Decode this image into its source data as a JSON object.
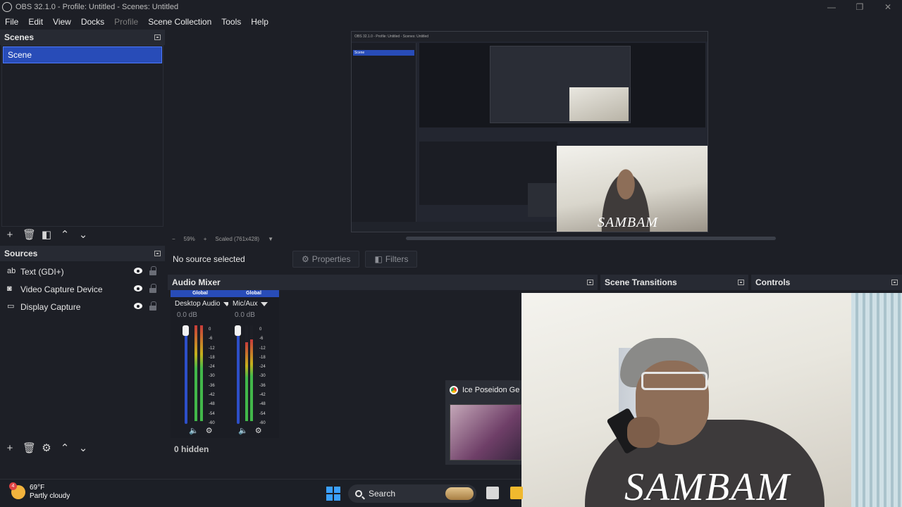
{
  "window": {
    "title": "OBS 32.1.0 - Profile: Untitled - Scenes: Untitled",
    "controls": [
      "—",
      "❐",
      "✕"
    ]
  },
  "menu": [
    {
      "label": "File",
      "enabled": true
    },
    {
      "label": "Edit",
      "enabled": true
    },
    {
      "label": "View",
      "enabled": true
    },
    {
      "label": "Docks",
      "enabled": true
    },
    {
      "label": "Profile",
      "enabled": false
    },
    {
      "label": "Scene Collection",
      "enabled": true
    },
    {
      "label": "Tools",
      "enabled": true
    },
    {
      "label": "Help",
      "enabled": true
    }
  ],
  "scenes": {
    "title": "Scenes",
    "items": [
      "Scene"
    ]
  },
  "sources": {
    "title": "Sources",
    "items": [
      {
        "label": "Text (GDI+)",
        "icon": "text-icon"
      },
      {
        "label": "Video Capture Device",
        "icon": "camera-icon"
      },
      {
        "label": "Display Capture",
        "icon": "monitor-icon"
      }
    ]
  },
  "preview": {
    "zoom": "59%",
    "scale_mode": "Scaled (761x428)",
    "nested_caption": "SAMBAM",
    "nested_title": "OBS 32.1.0 - Profile: Untitled - Scenes: Untitled"
  },
  "context": {
    "no_source": "No source selected",
    "properties": "Properties",
    "filters": "Filters"
  },
  "mixer": {
    "title": "Audio Mixer",
    "channels": [
      {
        "badge": "Global",
        "name": "Desktop Audio",
        "db": "0.0 dB",
        "level": 0.0
      },
      {
        "badge": "Global",
        "name": "Mic/Aux",
        "db": "0.0 dB",
        "level": 0.0
      }
    ],
    "scale": [
      "0",
      "-6",
      "-12",
      "-18",
      "-24",
      "-30",
      "-36",
      "-42",
      "-48",
      "-54",
      "-60"
    ],
    "hidden": "0 hidden"
  },
  "transitions": {
    "title": "Scene Transitions"
  },
  "controls": {
    "title": "Controls"
  },
  "webcam": {
    "caption": "SAMBAM"
  },
  "chrome_popup": {
    "title": "Ice Poseidon Ge"
  },
  "taskbar": {
    "temp": "69°F",
    "condition": "Partly cloudy",
    "badge": "4",
    "search": "Search"
  },
  "colors": {
    "accent": "#284cb8",
    "background": "#1d1f26"
  }
}
